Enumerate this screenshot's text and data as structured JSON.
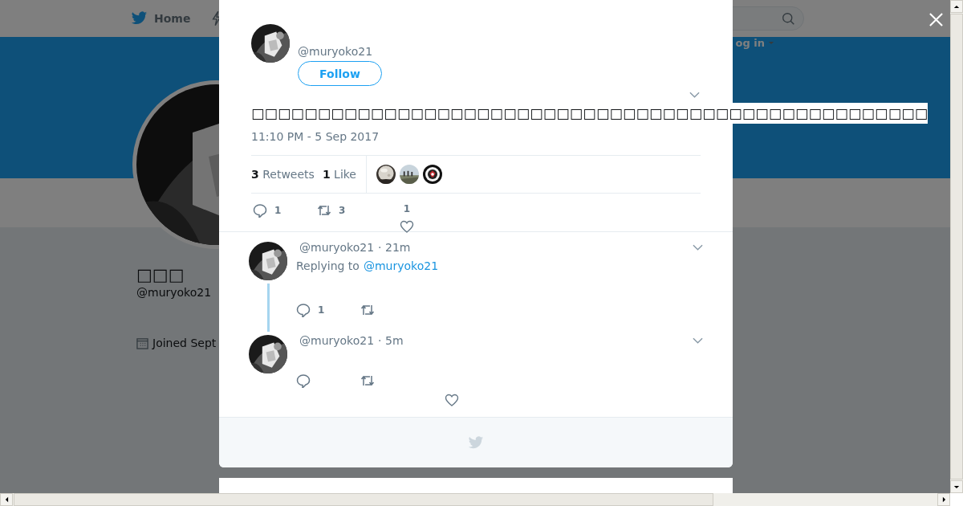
{
  "nav": {
    "home_label": "Home",
    "login_label": "og in"
  },
  "profile": {
    "name": "□□□",
    "handle": "@muryoko21",
    "joined": "Joined Sept"
  },
  "tweet": {
    "handle": "@muryoko21",
    "follow_label": "Follow",
    "text": "□□□□□□□□□□□□□□□□□□□□□□□□□□□□□□□□□□□□□□□□□□□□□□□□□□□",
    "time": "11:10 PM - 5 Sep 2017",
    "retweets_count": "3",
    "retweets_label": "Retweets",
    "likes_count": "1",
    "likes_label": "Like",
    "reply_count": "1",
    "retweet_count": "3",
    "like_count": "1"
  },
  "replies": [
    {
      "handle": "@muryoko21",
      "time": "· 21m",
      "replying_label": "Replying to",
      "replying_to": "@muryoko21",
      "reply_count": "1",
      "thread": true,
      "like_visible": false
    },
    {
      "handle": "@muryoko21",
      "time": "· 5m",
      "thread": false,
      "like_visible": true
    }
  ]
}
